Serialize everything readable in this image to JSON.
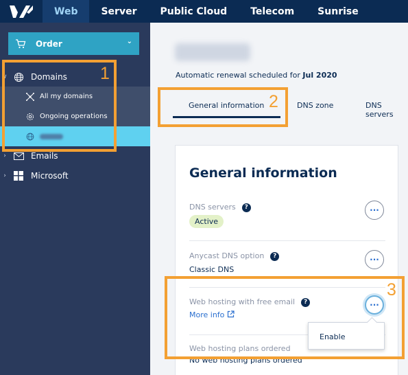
{
  "topnav": {
    "logo": "ovh-logo",
    "items": [
      {
        "label": "Web",
        "active": true
      },
      {
        "label": "Server",
        "active": false
      },
      {
        "label": "Public Cloud",
        "active": false
      },
      {
        "label": "Telecom",
        "active": false
      },
      {
        "label": "Sunrise",
        "active": false
      }
    ]
  },
  "sidebar": {
    "order_label": "Order",
    "domains_label": "Domains",
    "sub_items": [
      {
        "label": "All my domains",
        "icon": "network-icon"
      },
      {
        "label": "Ongoing operations",
        "icon": "gear-icon"
      }
    ],
    "emails_label": "Emails",
    "microsoft_label": "Microsoft"
  },
  "content": {
    "renewal_prefix": "Automatic renewal scheduled for ",
    "renewal_date": "Jul 2020",
    "tabs": [
      "General information",
      "DNS zone",
      "DNS servers"
    ],
    "card_title": "General information",
    "dns_servers_label": "DNS servers",
    "dns_servers_status": "Active",
    "anycast_label": "Anycast DNS option",
    "anycast_value": "Classic DNS",
    "hosting_label": "Web hosting with free email",
    "more_info_label": "More info",
    "plans_label": "Web hosting plans ordered",
    "plans_value": "No web hosting plans ordered",
    "dropdown_enable": "Enable"
  },
  "annotations": [
    "1",
    "2",
    "3"
  ],
  "colors": {
    "navy": "#0b2b53",
    "accent_orange": "#f3a033",
    "selected_blue": "#5fd1f0",
    "order_button": "#2fa3c4"
  }
}
